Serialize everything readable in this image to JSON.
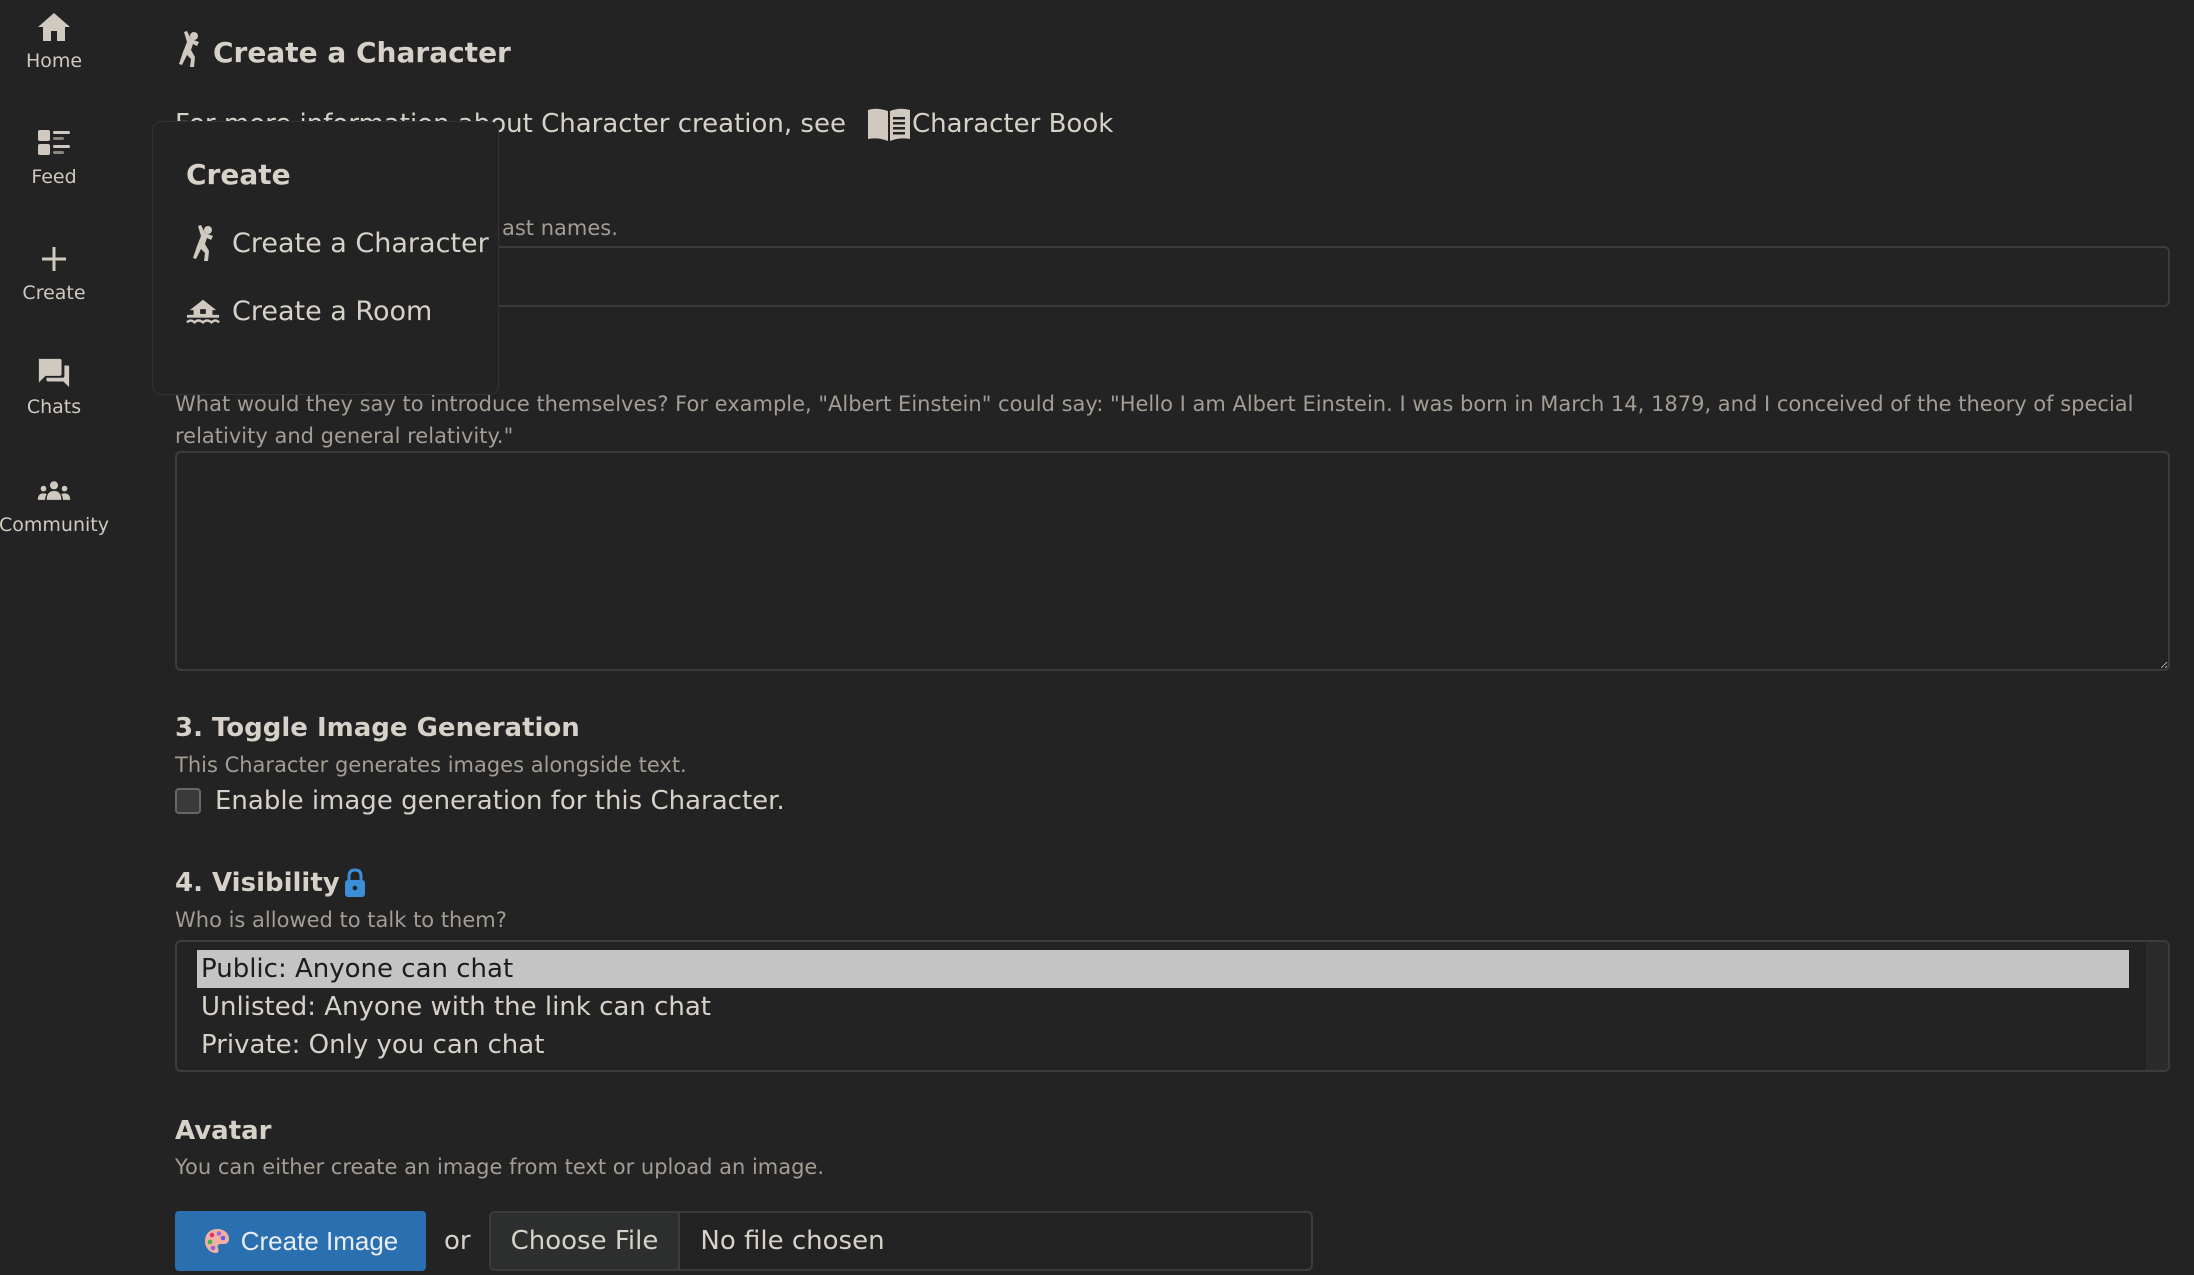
{
  "sidebar": {
    "items": [
      {
        "label": "Home",
        "icon": "home-icon"
      },
      {
        "label": "Feed",
        "icon": "feed-icon"
      },
      {
        "label": "Create",
        "icon": "plus-icon"
      },
      {
        "label": "Chats",
        "icon": "chats-icon"
      },
      {
        "label": "Community",
        "icon": "community-icon"
      }
    ]
  },
  "header": {
    "title": "Create a Character",
    "title_icon": "person-jumping-icon"
  },
  "info": {
    "text": "For more information about Character creation, see",
    "link_label": "Character Book",
    "link_icon": "book-icon"
  },
  "form": {
    "name": {
      "hint": "...first and last names.",
      "hint_visible": "ast names.",
      "value": ""
    },
    "description": {
      "hint": "What would they say to introduce themselves? For example, \"Albert Einstein\" could say: \"Hello I am Albert Einstein. I was born in March 14, 1879, and I conceived of the theory of special relativity and general relativity.\"",
      "value": ""
    },
    "image_generation": {
      "title": "3. Toggle Image Generation",
      "hint": "This Character generates images alongside text.",
      "checkbox_label": "Enable image generation for this Character.",
      "checked": false
    },
    "visibility": {
      "title": "4. Visibility",
      "title_icon": "lock-icon",
      "hint": "Who is allowed to talk to them?",
      "options": [
        "Public: Anyone can chat",
        "Unlisted: Anyone with the link can chat",
        "Private: Only you can chat"
      ],
      "selected": "Public: Anyone can chat"
    },
    "avatar": {
      "title": "Avatar",
      "hint": "You can either create an image from text or upload an image.",
      "create_button": "Create Image",
      "create_icon": "palette-icon",
      "or_text": "or",
      "choose_file": "Choose File",
      "file_status": "No file chosen"
    }
  },
  "create_menu": {
    "title": "Create",
    "items": [
      {
        "label": "Create a Character",
        "icon": "person-jumping-icon"
      },
      {
        "label": "Create a Room",
        "icon": "house-flood-icon"
      }
    ]
  },
  "colors": {
    "background": "#232323",
    "text": "#d6d1c9",
    "muted": "#a39d95",
    "accent": "#2a6fb0",
    "lock": "#3a8fd8"
  }
}
